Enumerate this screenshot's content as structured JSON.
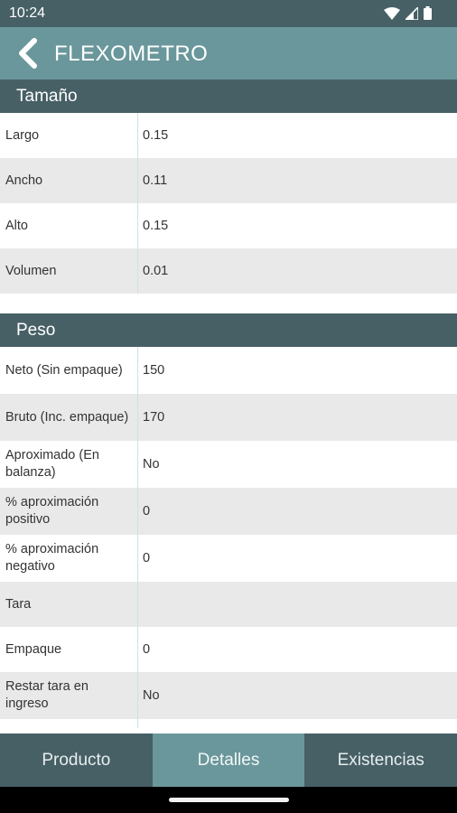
{
  "status": {
    "time": "10:24"
  },
  "header": {
    "title": "FLEXOMETRO"
  },
  "sections": {
    "tamano": {
      "title": "Tamaño",
      "rows": [
        {
          "label": "Largo",
          "value": "0.15"
        },
        {
          "label": "Ancho",
          "value": "0.11"
        },
        {
          "label": "Alto",
          "value": "0.15"
        },
        {
          "label": "Volumen",
          "value": "0.01"
        }
      ]
    },
    "peso": {
      "title": "Peso",
      "rows": [
        {
          "label": "Neto (Sin empaque)",
          "value": "150"
        },
        {
          "label": "Bruto (Inc. empaque)",
          "value": "170"
        },
        {
          "label": "Aproximado (En balanza)",
          "value": "No"
        },
        {
          "label": "% aproximación positivo",
          "value": "0"
        },
        {
          "label": "% aproximación negativo",
          "value": "0"
        },
        {
          "label": "Tara",
          "value": ""
        },
        {
          "label": "Empaque",
          "value": "0"
        },
        {
          "label": "Restar tara en ingreso",
          "value": "No"
        }
      ]
    }
  },
  "tabs": [
    {
      "label": "Producto",
      "active": false
    },
    {
      "label": "Detalles",
      "active": true
    },
    {
      "label": "Existencias",
      "active": false
    }
  ],
  "colors": {
    "dark": "#476066",
    "accent": "#6a979b",
    "alt_row": "#e9e9e9"
  }
}
